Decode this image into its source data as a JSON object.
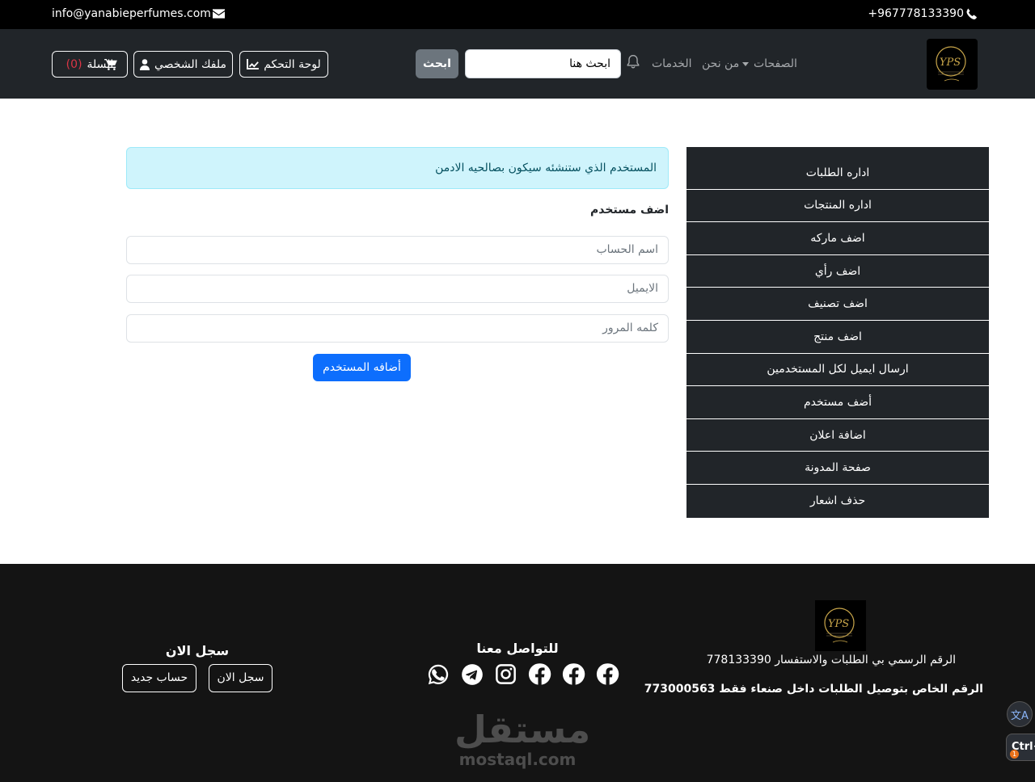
{
  "topbar": {
    "email": "info@yanabieperfumes.com",
    "phone": "+967778133390"
  },
  "navbar": {
    "links": {
      "pages": "الصفحات",
      "about": "من نحن",
      "services": "الخدمات"
    },
    "search": {
      "value": "ابحث هنا",
      "button": "ابحث"
    },
    "buttons": {
      "dashboard": "لوحة التحكم",
      "profile": "ملفك الشخصي",
      "cart": "السلة",
      "cart_count": "(0)"
    }
  },
  "sidebar": {
    "items": [
      {
        "label": "اداره الطلبات"
      },
      {
        "label": "اداره المنتجات"
      },
      {
        "label": "اضف ماركه"
      },
      {
        "label": "اضف رأي"
      },
      {
        "label": "اضف تصنيف"
      },
      {
        "label": "اضف منتج"
      },
      {
        "label": "ارسال ايميل لكل المستخدمين"
      },
      {
        "label": "أضف مستخدم"
      },
      {
        "label": "اضافة اعلان"
      },
      {
        "label": "صفحة المدونة"
      },
      {
        "label": "حذف اشعار"
      }
    ]
  },
  "main": {
    "alert": "المستخدم الذي ستنشئه سيكون بصالحيه الادمن",
    "form_title": "اضف مستخدم",
    "fields": {
      "username_placeholder": "اسم الحساب",
      "email_placeholder": "الايميل",
      "password_placeholder": "كلمه المرور"
    },
    "submit": "أضافه المستخدم"
  },
  "footer": {
    "line1": "الرقم الرسمي بي الطلبات والاستفسار 778133390",
    "line2": "الرقم الخاص بتوصيل الطلبات داخل صنعاء فقط  773000563",
    "contact_title": "للتواصل معنا",
    "register_title": "سجل الان",
    "login_button": "سجل الان",
    "new_account_button": "حساب جديد",
    "watermark_ar": "مستقل",
    "watermark_en": "mostaql.com"
  },
  "overlay": {
    "ctrl_label": "Ctrl+",
    "badge": "1"
  },
  "colors": {
    "topbar": "#000000",
    "navbar": "#212529",
    "primary": "#0d6efd",
    "alert_bg": "#cff4fc",
    "footer": "#141414",
    "cart_count": "#dc3545"
  }
}
